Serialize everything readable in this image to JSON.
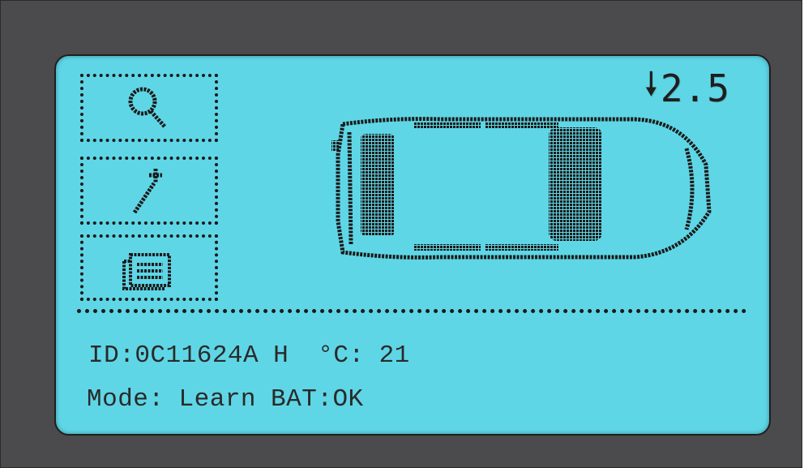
{
  "screen": {
    "pressure": {
      "arrow_icon": "down-arrow-icon",
      "value": "2.5"
    },
    "menu": [
      {
        "icon": "search-icon"
      },
      {
        "icon": "wrench-icon"
      },
      {
        "icon": "list-icon"
      }
    ],
    "vehicle": {
      "icon": "car-top-view-icon"
    },
    "info": {
      "id_label": "ID:",
      "id_value": "0C11624A",
      "id_suffix": "H",
      "temp_label": "°C:",
      "temp_value": "21",
      "mode_label": "Mode:",
      "mode_value": "Learn",
      "battery_label": "BAT:",
      "battery_value": "OK"
    }
  },
  "colors": {
    "lcd_background": "#5fd6e6",
    "bezel": "#4b4b4d",
    "pixel_ink": "#1a1a1a"
  }
}
